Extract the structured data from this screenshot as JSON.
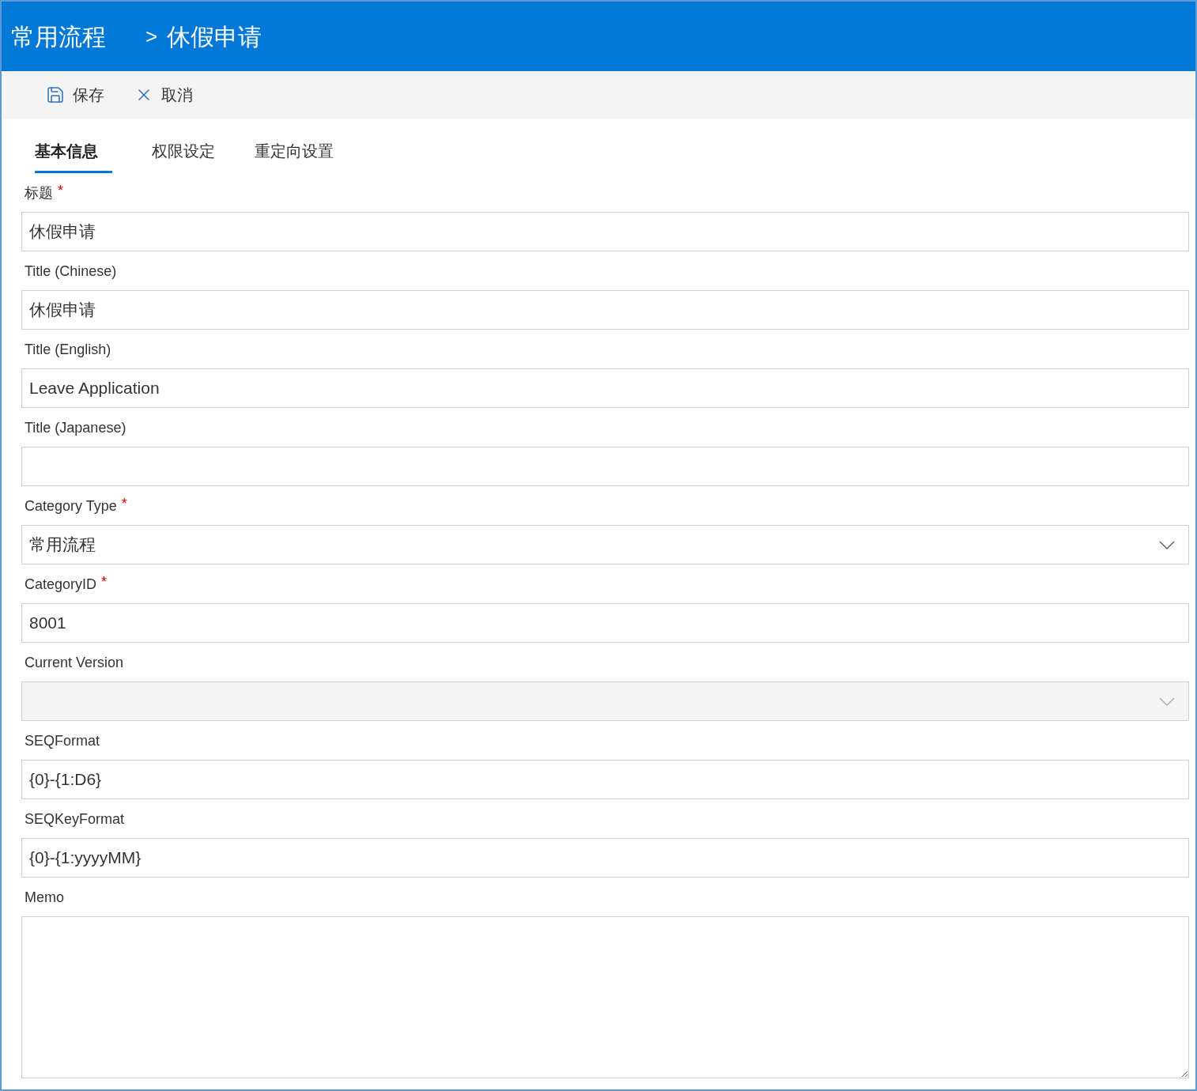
{
  "breadcrumb": {
    "parent": "常用流程",
    "separator": ">",
    "current": "休假申请"
  },
  "toolbar": [
    {
      "kind": "save",
      "label": "保存"
    },
    {
      "kind": "cancel",
      "label": "取消"
    }
  ],
  "tabs": [
    {
      "label": "基本信息",
      "selected": true
    },
    {
      "label": "权限设定",
      "selected": false
    },
    {
      "label": "重定向设置",
      "selected": false
    }
  ],
  "fields": [
    {
      "label": "标题",
      "required_mark": "*",
      "kind": "text",
      "value": "休假申请"
    },
    {
      "label": "Title (Chinese)",
      "kind": "text",
      "value": "休假申请"
    },
    {
      "label": "Title (English)",
      "kind": "text",
      "value": "Leave Application"
    },
    {
      "label": "Title (Japanese)",
      "kind": "text"
    },
    {
      "label": "Category Type",
      "required_mark": "*",
      "kind": "select",
      "value": "常用流程",
      "disabled": false
    },
    {
      "label": "CategoryID",
      "required_mark": "*",
      "kind": "text",
      "value": "8001"
    },
    {
      "label": "Current Version",
      "kind": "select",
      "disabled": true
    },
    {
      "label": "SEQFormat",
      "kind": "text",
      "value": "{0}-{1:D6}"
    },
    {
      "label": "SEQKeyFormat",
      "kind": "text",
      "value": "{0}-{1:yyyyMM}"
    },
    {
      "label": "Memo",
      "kind": "textarea"
    }
  ]
}
